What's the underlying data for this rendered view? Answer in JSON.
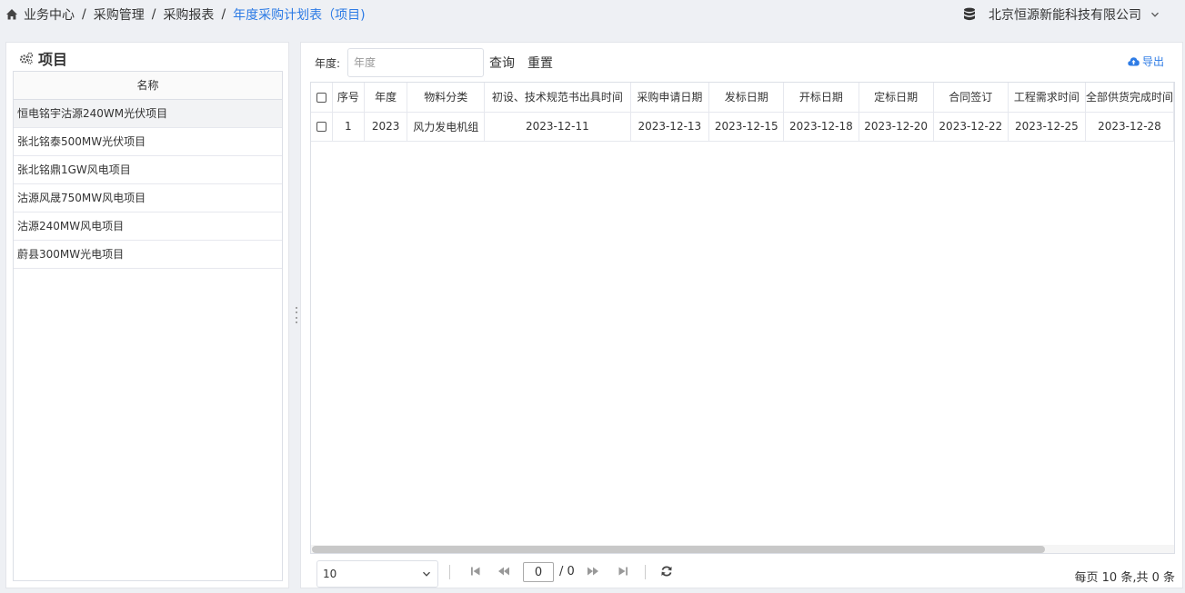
{
  "breadcrumb": {
    "items": [
      "业务中心",
      "采购管理",
      "采购报表"
    ],
    "current": "年度采购计划表（项目)",
    "separator": "/"
  },
  "header": {
    "company": "北京恒源新能科技有限公司"
  },
  "left_panel": {
    "title": "项目",
    "column": "名称",
    "items": [
      "恒电铭宇沽源240WM光伏项目",
      "张北铭泰500MW光伏项目",
      "张北铭鼎1GW风电项目",
      "沽源风晟750MW风电项目",
      "沽源240MW风电项目",
      "蔚县300MW光电项目"
    ]
  },
  "filter": {
    "year_label": "年度:",
    "year_placeholder": "年度",
    "query_label": "查询",
    "reset_label": "重置",
    "export_label": "导出"
  },
  "table": {
    "columns": [
      "序号",
      "年度",
      "物料分类",
      "初设、技术规范书出具时间",
      "采购申请日期",
      "发标日期",
      "开标日期",
      "定标日期",
      "合同签订",
      "工程需求时间",
      "全部供货完成时间"
    ],
    "rows": [
      [
        "1",
        "2023",
        "风力发电机组",
        "2023-12-11",
        "2023-12-13",
        "2023-12-15",
        "2023-12-18",
        "2023-12-20",
        "2023-12-22",
        "2023-12-25",
        "2023-12-28"
      ]
    ]
  },
  "pagination": {
    "page_size": "10",
    "current_page": "0",
    "total_pages": "/ 0",
    "summary": "每页 10 条,共 0 条"
  },
  "colors": {
    "accent": "#2d7be5",
    "background": "#eef0f4",
    "border": "#dcdfe6"
  }
}
